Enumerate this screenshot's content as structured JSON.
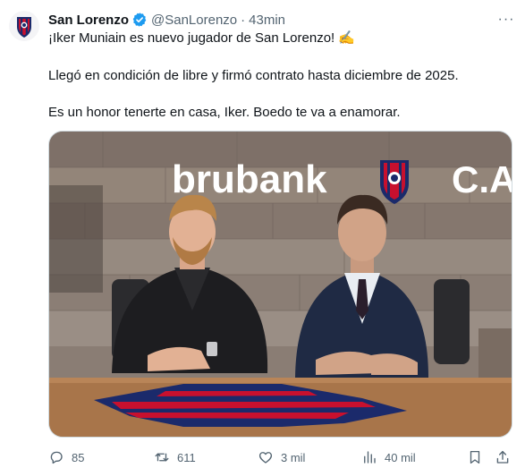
{
  "tweet": {
    "author_name": "San Lorenzo",
    "handle": "@SanLorenzo",
    "separator": "·",
    "time": "43min",
    "more_label": "···",
    "text_line1": "¡Iker Muniain es nuevo jugador de San Lorenzo! ✍️",
    "text_line2": "Llegó en condición de libre y firmó contrato hasta diciembre de 2025.",
    "text_line3": "Es un honor tenerte en casa, Iker. Boedo te va a enamorar."
  },
  "media": {
    "wall_brand": "brubank",
    "wall_suffix": "C.A"
  },
  "actions": {
    "replies": "85",
    "reposts": "611",
    "likes": "3 mil",
    "views": "40 mil"
  },
  "colors": {
    "text": "#0f1419",
    "secondary": "#536471",
    "verified": "#1d9bf0",
    "club_blue": "#1b2a6b",
    "club_red": "#c8102e"
  }
}
